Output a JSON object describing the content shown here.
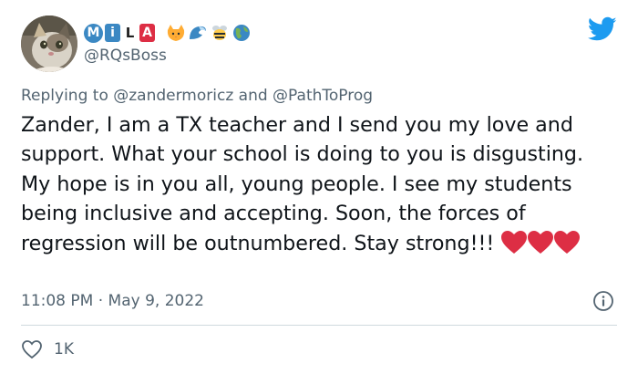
{
  "author": {
    "display_name_letters": [
      "M",
      "i",
      "L",
      "A"
    ],
    "name_emojis": [
      "cat-face",
      "wave",
      "bee",
      "globe"
    ],
    "handle": "@RQsBoss"
  },
  "reply": {
    "prefix": "Replying to",
    "mention_1": "@zandermoricz",
    "conjunction": "and",
    "mention_2": "@PathToProg"
  },
  "tweet": {
    "text": "Zander, I am a TX teacher and I send you my love and support. What your school is doing to you is disgusting. My hope is in you all, young people. I see my students being inclusive and accepting. Soon, the forces of regression will be outnumbered. Stay strong!!!",
    "emoji_hearts": 3
  },
  "meta": {
    "time": "11:08 PM",
    "separator": "·",
    "date": "May 9, 2022"
  },
  "actions": {
    "like_count": "1K"
  },
  "colors": {
    "twitter_blue": "#1d9bf0",
    "heart_red": "#dd2e44",
    "secondary_text": "#536471"
  }
}
